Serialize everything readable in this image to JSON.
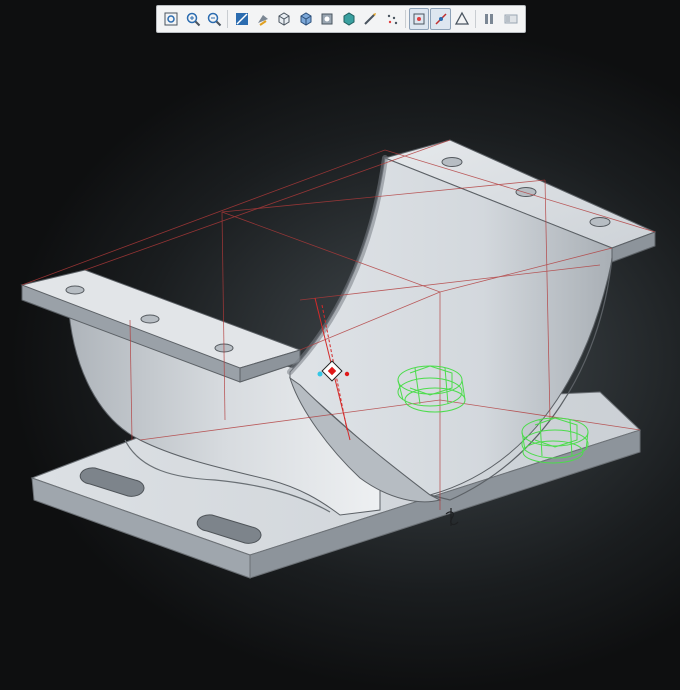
{
  "toolbar": {
    "items": [
      {
        "icon": "zoom-to-fit-icon"
      },
      {
        "icon": "zoom-in-icon"
      },
      {
        "icon": "zoom-out-icon"
      },
      {
        "icon": "previous-view-icon"
      },
      {
        "icon": "section-view-icon"
      },
      {
        "icon": "view-orientation-icon"
      },
      {
        "icon": "display-style-icon"
      },
      {
        "icon": "hide-show-items-icon"
      },
      {
        "icon": "edit-appearance-icon"
      },
      {
        "icon": "apply-scene-icon"
      },
      {
        "icon": "view-settings-icon"
      },
      {
        "icon": "view-sketch-relations-icon",
        "active": true
      },
      {
        "icon": "sketch-fillet-icon",
        "active": true
      },
      {
        "icon": "triad-icon"
      },
      {
        "icon": "pause-icon"
      },
      {
        "icon": "display-pane-icon"
      }
    ]
  },
  "colors": {
    "model_face": "#c9cfd5",
    "model_edge": "#5c6166",
    "sketch_line": "#b23a3a",
    "hardware_outline": "#4cdc4c",
    "origin_marker": "#e01818",
    "toolbar_bg": "#f3f4f5"
  }
}
